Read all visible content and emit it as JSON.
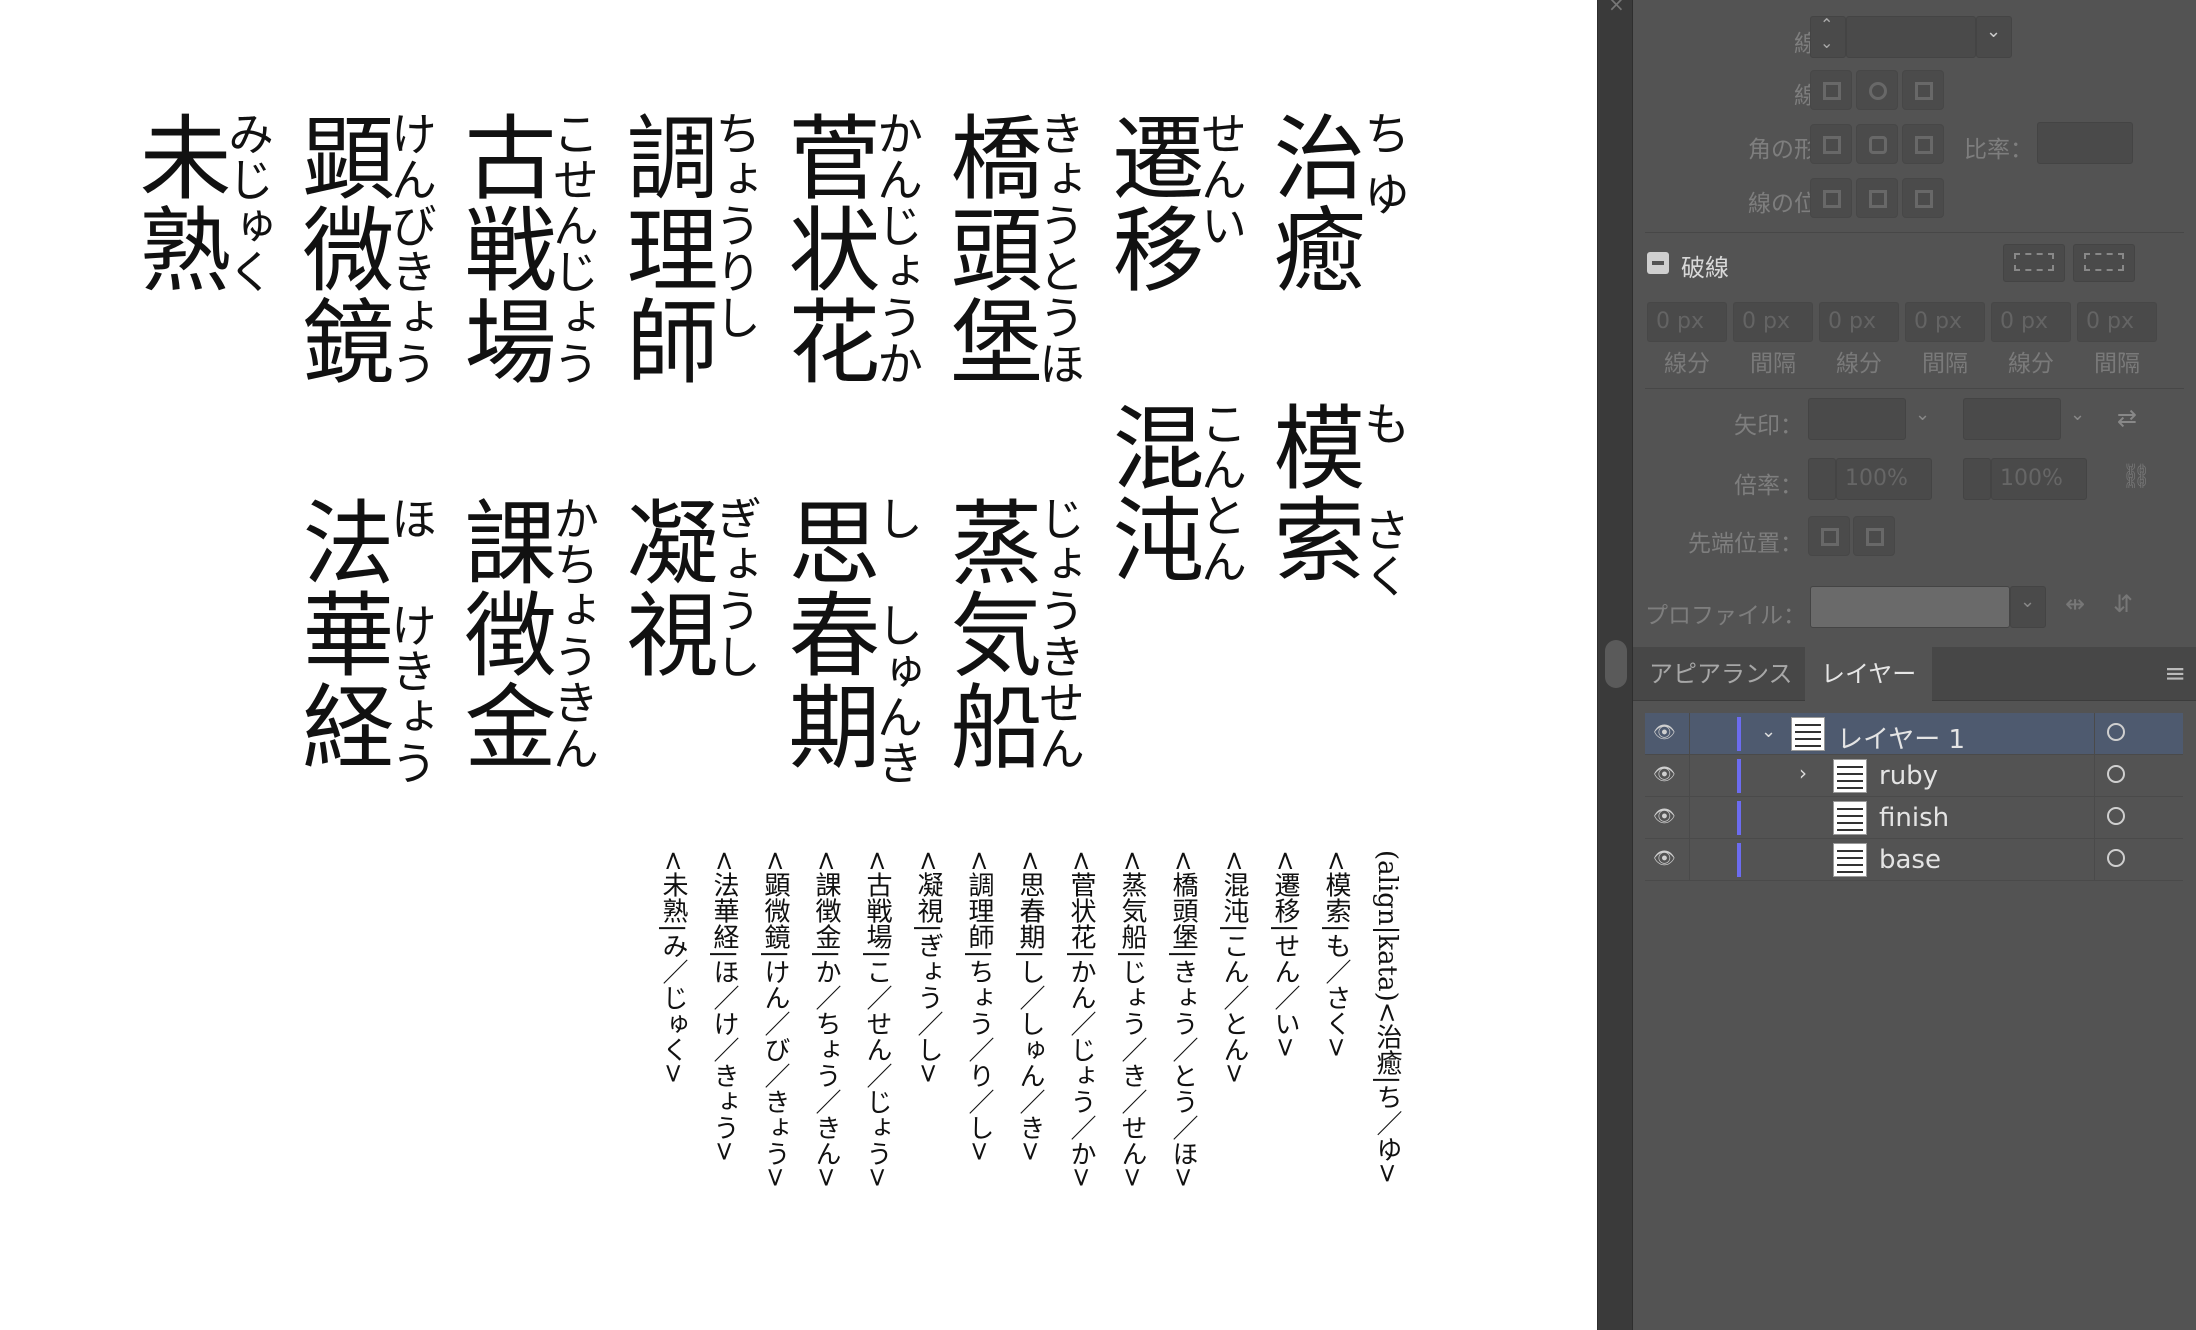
{
  "canvas": {
    "display": [
      {
        "kanji": "治癒",
        "ruby": "ち ゆ"
      },
      {
        "kanji": "遷移",
        "ruby": "せんい"
      },
      {
        "kanji": "橋頭堡",
        "ruby": "きょうとうほ"
      },
      {
        "kanji": "菅状花",
        "ruby": "かんじょうか"
      },
      {
        "kanji": "調理師",
        "ruby": "ちょうりし"
      },
      {
        "kanji": "古戦場",
        "ruby": "こせんじょう"
      },
      {
        "kanji": "顕微鏡",
        "ruby": "けんびきょう"
      },
      {
        "kanji": "未熟",
        "ruby": "みじゅく"
      },
      {
        "kanji": "模索",
        "ruby": "も　 さく"
      },
      {
        "kanji": "混沌",
        "ruby": "こんとん"
      },
      {
        "kanji": "蒸気船",
        "ruby": "じょうきせん"
      },
      {
        "kanji": "思春期",
        "ruby": "し　 しゅんき"
      },
      {
        "kanji": "凝視",
        "ruby": "ぎょうし"
      },
      {
        "kanji": "課徴金",
        "ruby": "かちょうきん"
      },
      {
        "kanji": "法華経",
        "ruby": "ほ　 けきょう"
      }
    ],
    "source": [
      "(align|kata)<治癒|ち／ゆ>",
      "<模索|も／さく>",
      "<遷移|せん／い>",
      "<混沌|こん／とん>",
      "<橋頭堡|きょう／とう／ほ>",
      "<蒸気船|じょう／き／せん>",
      "<菅状花|かん／じょう／か>",
      "<思春期|し／しゅん／き>",
      "<調理師|ちょう／り／し>",
      "<凝視|ぎょう／し>",
      "<古戦場|こ／せん／じょう>",
      "<課徴金|か／ちょう／きん>",
      "<顕微鏡|けん／び／きょう>",
      "<法華経|ほ／け／きょう>",
      "<未熟|み／じゅく>"
    ]
  },
  "stroke_panel": {
    "width_label": "線幅：",
    "cap_label": "線端：",
    "corner_label": "角の形状：",
    "limit_label": "比率：",
    "align_label": "線の位置：",
    "dashed_label": "破線",
    "dash_fields": [
      "0 px",
      "0 px",
      "0 px",
      "0 px",
      "0 px",
      "0 px"
    ],
    "dash_sublabels": [
      "線分",
      "間隔",
      "線分",
      "間隔",
      "線分",
      "間隔"
    ],
    "arrow_label": "矢印：",
    "scale_label": "倍率：",
    "scale_values": [
      "100%",
      "100%"
    ],
    "tip_label": "先端位置：",
    "profile_label": "プロファイル："
  },
  "tabs": [
    "アピアランス",
    "レイヤー"
  ],
  "layers": [
    {
      "name": "レイヤー 1"
    },
    {
      "name": "ruby"
    },
    {
      "name": "finish"
    },
    {
      "name": "base"
    }
  ],
  "colors": {
    "panel_bg": "#535353",
    "selected_row": "#4e5a6f",
    "layer_color": "#6c6cf0"
  }
}
